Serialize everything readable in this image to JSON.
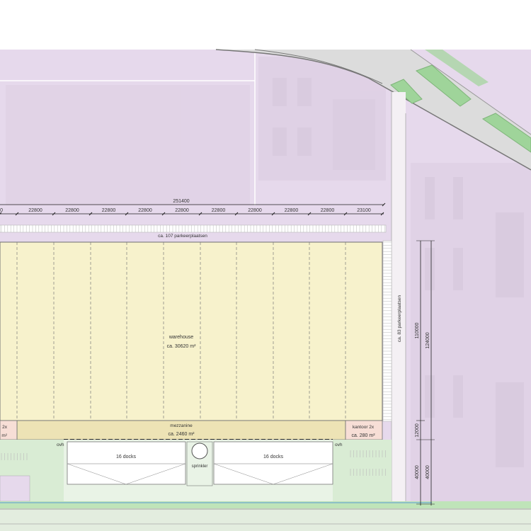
{
  "plan": {
    "total_width_label": "251400",
    "bay_labels": [
      "00",
      "22800",
      "22800",
      "22800",
      "22800",
      "22800",
      "22800",
      "22800",
      "22800",
      "22800",
      "23100"
    ],
    "parking_top": "ca. 107 parkeerplaatsen",
    "parking_right": "ca. 83 parkeerplaatsen",
    "warehouse": {
      "title": "warehouse",
      "area": "ca. 30620 m²"
    },
    "mezzanine": {
      "title": "mezzanine",
      "area": "ca. 2460 m²"
    },
    "office_left": {
      "title": "2x",
      "area": "m²"
    },
    "office_right": {
      "title": "kantoor 2x",
      "area": "ca. 280 m²"
    },
    "ovh_labels": [
      "ovh",
      "ovh"
    ],
    "docks": [
      "16 docks",
      "16 docks"
    ],
    "sprinkler": "sprinkler",
    "dims_vertical": [
      "110000",
      "12000",
      "124000",
      "40000",
      "40000"
    ]
  },
  "colors": {
    "site_purple": "#e6d9ec",
    "warehouse_fill": "#f7f2cc",
    "mezzanine_fill": "#ede3b5",
    "office_fill": "#f7ded6",
    "green": "#9fd49a",
    "road": "#dcdcdc"
  }
}
